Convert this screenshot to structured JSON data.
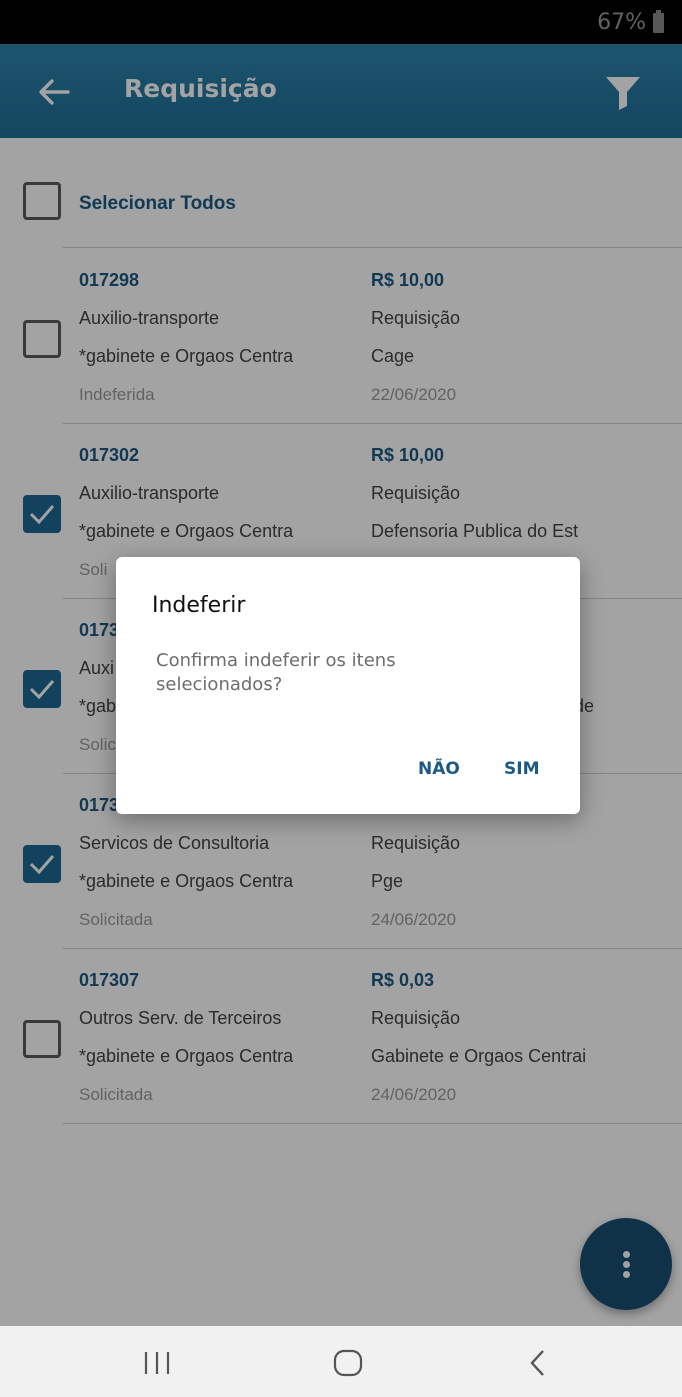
{
  "statusbar": {
    "battery": "67%"
  },
  "appbar": {
    "title": "Requisição",
    "back_icon": "arrow-left-icon",
    "filter_icon": "filter-icon"
  },
  "list": {
    "select_all_label": "Selecionar Todos",
    "rows": [
      {
        "code": "017298",
        "value": "R$ 10,00",
        "type": "Auxilio-transporte",
        "kind": "Requisição",
        "org": "*gabinete e Orgaos Centra",
        "dept": "Cage",
        "status": "Indeferida",
        "date": "22/06/2020",
        "checked": false
      },
      {
        "code": "017302",
        "value": "R$ 10,00",
        "type": "Auxilio-transporte",
        "kind": "Requisição",
        "org": "*gabinete e Orgaos Centra",
        "dept": "Defensoria Publica do Est",
        "status": "Soli",
        "date": "",
        "checked": true
      },
      {
        "code": "0173",
        "value": "",
        "type": "Auxi",
        "kind": "",
        "org": "*gab",
        "dept": "de",
        "status": "Solic",
        "date": "",
        "checked": true
      },
      {
        "code": "0173",
        "value": "",
        "type": "Servicos de Consultoria",
        "kind": "Requisição",
        "org": "*gabinete e Orgaos Centra",
        "dept": "Pge",
        "status": "Solicitada",
        "date": "24/06/2020",
        "checked": true
      },
      {
        "code": "017307",
        "value": "R$ 0,03",
        "type": "Outros Serv. de Terceiros",
        "kind": "Requisição",
        "org": "*gabinete e Orgaos Centra",
        "dept": "Gabinete e Orgaos Centrai",
        "status": "Solicitada",
        "date": "24/06/2020",
        "checked": false
      }
    ]
  },
  "dialog": {
    "title": "Indeferir",
    "message": "Confirma indeferir os itens selecionados?",
    "no_label": "NÃO",
    "yes_label": "SIM"
  },
  "fab": {
    "icon": "more-vertical-icon"
  },
  "navbar": {
    "recents_icon": "recents-icon",
    "home_icon": "home-icon",
    "back_icon": "nav-back-icon"
  },
  "colors": {
    "appbar": "#2479a2",
    "accent": "#1d5a83",
    "checked": "#1d6893",
    "fab": "#184f72"
  }
}
